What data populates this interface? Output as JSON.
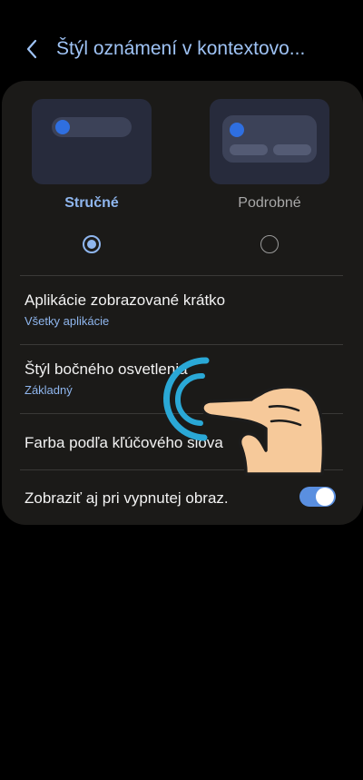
{
  "header": {
    "title": "Štýl oznámení v kontextovo..."
  },
  "styles": {
    "brief_label": "Stručné",
    "detail_label": "Podrobné",
    "selected": "brief",
    "accent": "#8fb6ee"
  },
  "settings": {
    "apps": {
      "title": "Aplikácie zobrazované krátko",
      "subtitle": "Všetky aplikácie"
    },
    "edge_lighting": {
      "title": "Štýl bočného osvetlenia",
      "subtitle": "Základný"
    },
    "keyword_color": {
      "title": "Farba podľa kľúčového slova"
    },
    "show_when_off": {
      "title": "Zobraziť aj pri vypnutej obraz.",
      "enabled": true
    }
  }
}
